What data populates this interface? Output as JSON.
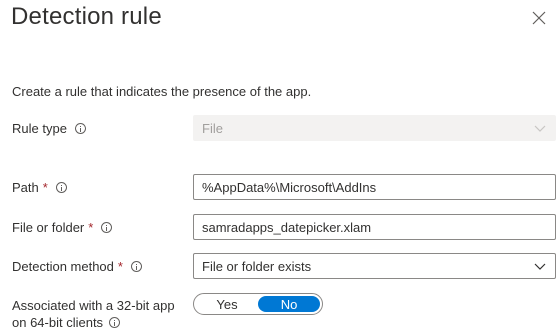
{
  "panel": {
    "title": "Detection rule",
    "close_icon": "close-icon",
    "description": "Create a rule that indicates the presence of the app."
  },
  "rule_type": {
    "label": "Rule type",
    "value": "File",
    "disabled": true
  },
  "path": {
    "label": "Path",
    "required_mark": "*",
    "value": "%AppData%\\Microsoft\\AddIns"
  },
  "file_or_folder": {
    "label": "File or folder",
    "required_mark": "*",
    "value": "samradapps_datepicker.xlam"
  },
  "detection_method": {
    "label": "Detection method",
    "required_mark": "*",
    "value": "File or folder exists"
  },
  "associated": {
    "label_line1": "Associated with a 32-bit app",
    "label_line2": "on 64-bit clients",
    "options": [
      "Yes",
      "No"
    ],
    "selected": "No"
  },
  "colors": {
    "accent": "#0078d4",
    "required": "#a4262c",
    "disabled_bg": "#f3f2f1"
  }
}
